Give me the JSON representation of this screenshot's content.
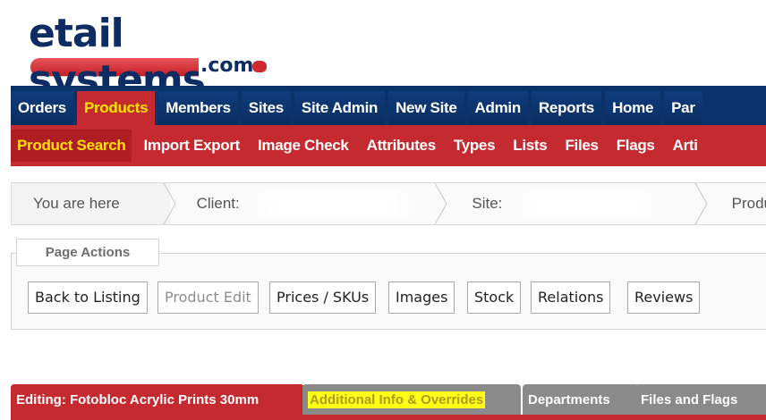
{
  "logo": {
    "brand": "etail systems",
    "suffix": ".com"
  },
  "main_nav": {
    "tabs": [
      {
        "label": "Orders"
      },
      {
        "label": "Products",
        "active": true
      },
      {
        "label": "Members"
      },
      {
        "label": "Sites"
      },
      {
        "label": "Site Admin"
      },
      {
        "label": "New Site"
      },
      {
        "label": "Admin"
      },
      {
        "label": "Reports"
      },
      {
        "label": "Home"
      },
      {
        "label": "Par"
      }
    ]
  },
  "sub_nav": {
    "tabs": [
      {
        "label": "Product Search",
        "active": true
      },
      {
        "label": "Import Export"
      },
      {
        "label": "Image Check"
      },
      {
        "label": "Attributes"
      },
      {
        "label": "Types"
      },
      {
        "label": "Lists"
      },
      {
        "label": "Files"
      },
      {
        "label": "Flags"
      },
      {
        "label": "Arti"
      }
    ]
  },
  "breadcrumb": {
    "you_are_here": "You are here",
    "client_label": "Client:",
    "site_label": "Site:",
    "product_label": "Produ"
  },
  "page_actions": {
    "legend": "Page Actions",
    "buttons": [
      {
        "label": "Back to Listing"
      },
      {
        "label": "Product Edit",
        "disabled": true
      },
      {
        "label": "Prices / SKUs"
      },
      {
        "label": "Images"
      },
      {
        "label": "Stock"
      },
      {
        "label": "Relations"
      },
      {
        "label": "Reviews"
      }
    ]
  },
  "editing_tabs": [
    {
      "label": "Editing: Fotobloc Acrylic Prints 30mm"
    },
    {
      "label": "Additional Info & Overrides"
    },
    {
      "label": "Departments"
    },
    {
      "label": "Files and Flags"
    }
  ],
  "colors": {
    "navy": "#0c3369",
    "red": "#c52a30",
    "highlight_yellow": "#ffe300",
    "tab_grey": "#8a8a8a"
  }
}
